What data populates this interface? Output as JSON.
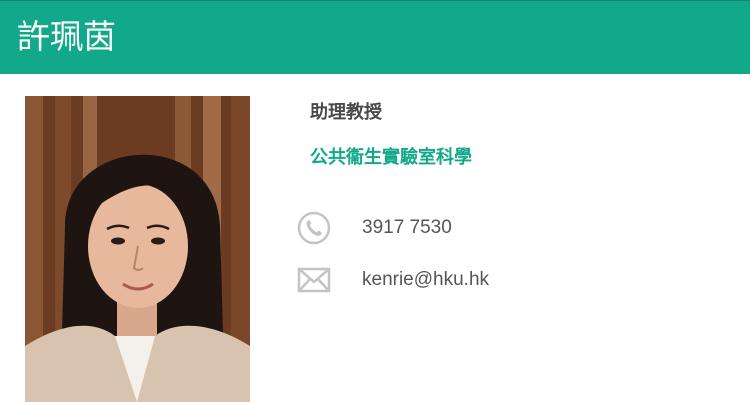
{
  "header": {
    "name": "許珮茵"
  },
  "profile": {
    "position": "助理教授",
    "department": "公共衞生實驗室科學",
    "photo_icon": "person-photo"
  },
  "contacts": {
    "phone": {
      "icon": "phone-icon",
      "value": "3917 7530"
    },
    "email": {
      "icon": "envelope-icon",
      "value": "kenrie@hku.hk"
    }
  },
  "colors": {
    "accent": "#12a98a",
    "text": "#4a4a4a",
    "icon": "#c8c8c8"
  }
}
